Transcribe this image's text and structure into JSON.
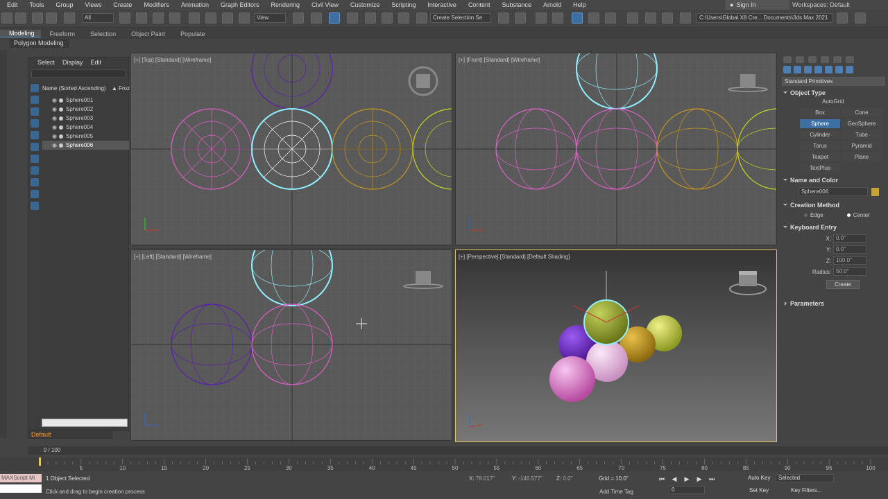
{
  "menubar": {
    "items": [
      "Edit",
      "Tools",
      "Group",
      "Views",
      "Create",
      "Modifiers",
      "Animation",
      "Graph Editors",
      "Rendering",
      "Civil View",
      "Customize",
      "Scripting",
      "Interactive",
      "Content",
      "Substance",
      "Arnold",
      "Help"
    ],
    "sign_in": "Sign In",
    "workspaces_label": "Workspaces:",
    "workspaces_value": "Default"
  },
  "toolbar": {
    "selection_filter": "All",
    "ref_coord": "View",
    "named_selection": "Create Selection Se",
    "project_path": "C:\\Users\\Global X8 Cre... Documents\\3ds Max 2021"
  },
  "ribbon": {
    "tabs": [
      "Modeling",
      "Freeform",
      "Selection",
      "Object Paint",
      "Populate"
    ],
    "active_tab": "Modeling",
    "panel_label": "Polygon Modeling"
  },
  "scene_explorer": {
    "tabs": [
      "Select",
      "Display",
      "Edit"
    ],
    "column_header": "Name (Sorted Ascending)",
    "freeze_col": "▲ Froz",
    "objects": [
      "Sphere001",
      "Sphere002",
      "Sphere003",
      "Sphere004",
      "Sphere005",
      "Sphere006"
    ],
    "selected_object": "Sphere006",
    "layer": "Default"
  },
  "viewports": {
    "top": "[+] [Top] [Standard] [Wireframe]",
    "front": "[+] [Front] [Standard] [Wireframe]",
    "left": "[+] [Left] [Standard] [Wireframe]",
    "perspective": "[+] [Perspective] [Standard] [Default Shading]"
  },
  "command_panel": {
    "category": "Standard Primitives",
    "object_type_title": "Object Type",
    "autogrid": "AutoGrid",
    "primitives": [
      "Box",
      "Cone",
      "Sphere",
      "GeoSphere",
      "Cylinder",
      "Tube",
      "Torus",
      "Pyramid",
      "Teapot",
      "Plane",
      "TextPlus"
    ],
    "selected_primitive": "Sphere",
    "name_color_title": "Name and Color",
    "object_name": "Sphere006",
    "object_color": "#c7a23a",
    "creation_method_title": "Creation Method",
    "creation_methods": [
      "Edge",
      "Center"
    ],
    "creation_method_selected": "Center",
    "keyboard_entry_title": "Keyboard Entry",
    "kb_x_label": "X:",
    "kb_x": "0.0\"",
    "kb_y_label": "Y:",
    "kb_y": "0.0\"",
    "kb_z_label": "Z:",
    "kb_z": "100.0\"",
    "kb_radius_label": "Radius:",
    "kb_radius": "50.0\"",
    "create_button": "Create",
    "parameters_title": "Parameters"
  },
  "timeline": {
    "frame_counter": "0 / 100",
    "ticks": [
      "5",
      "10",
      "15",
      "20",
      "25",
      "30",
      "35",
      "40",
      "45",
      "50",
      "55",
      "60",
      "65",
      "70",
      "75",
      "80",
      "85",
      "90",
      "95",
      "100"
    ]
  },
  "status": {
    "maxscript": "MAXScript Mi",
    "selection": "1 Object Selected",
    "prompt": "Click and drag to begin creation process",
    "x_label": "X:",
    "x_value": "78.017\"",
    "y_label": "Y:",
    "y_value": "-146.577\"",
    "z_label": "Z:",
    "z_value": "0.0\"",
    "grid": "Grid = 10.0\"",
    "add_time_tag": "Add Time Tag",
    "auto_key": "Auto Key",
    "selected_set": "Selected",
    "set_key": "Set Key",
    "key_filters": "Key Filters...",
    "current_frame": "0"
  },
  "colors": {
    "pink": "#e060c8",
    "cyan": "#8ff0ff",
    "yellow": "#c89820",
    "lime": "#c8d820",
    "purple": "#5a1cb0",
    "accent": "#5b9ad6"
  }
}
